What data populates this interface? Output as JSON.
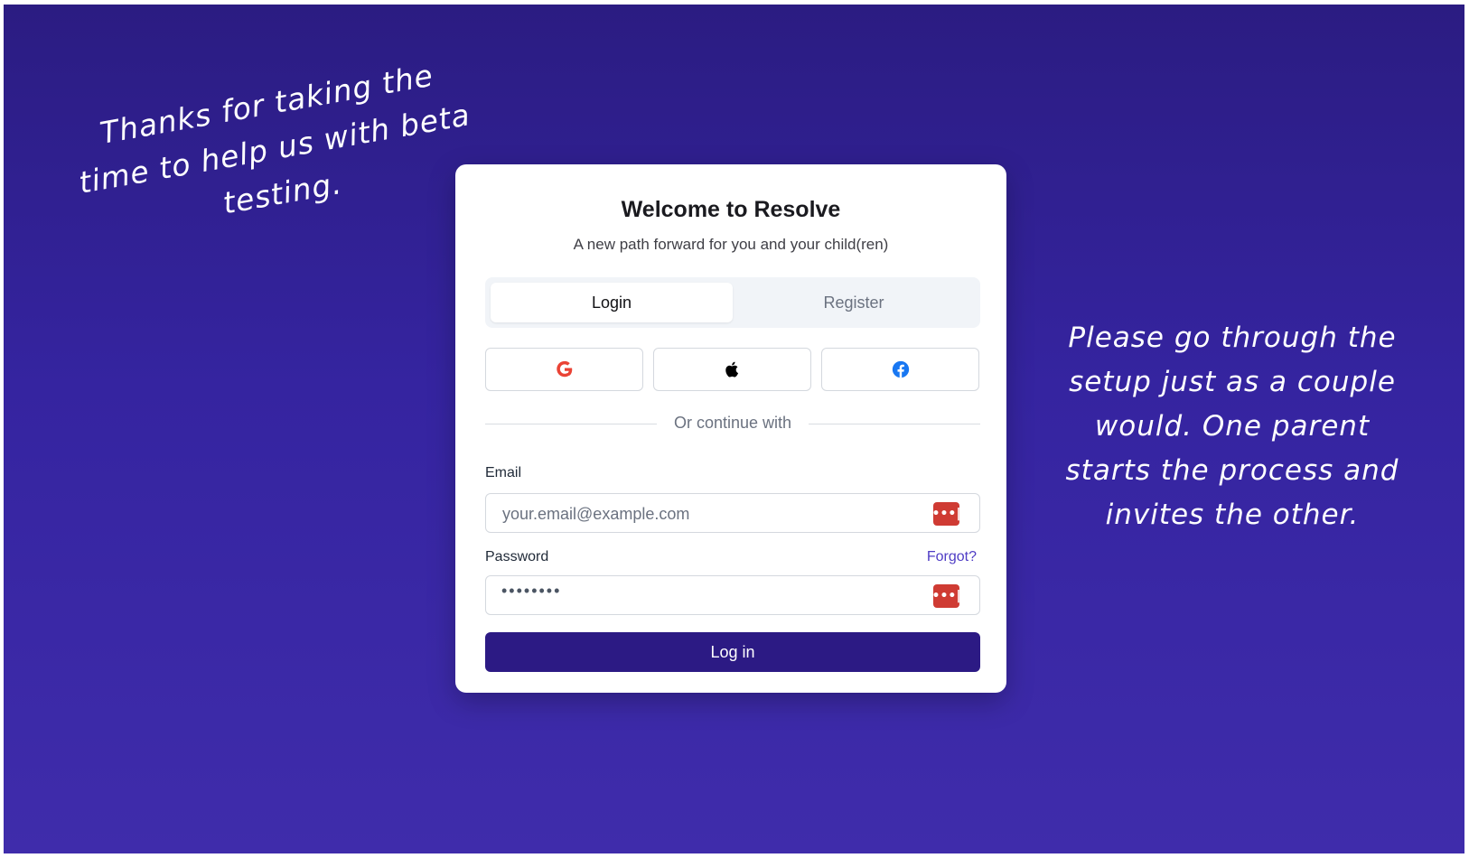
{
  "notes": {
    "left": "Thanks for taking the time to help us with beta testing.",
    "right": "Please go through the setup just as a couple would. One parent starts the process and invites the other."
  },
  "card": {
    "title": "Welcome to Resolve",
    "subtitle": "A new path forward for you and your child(ren)"
  },
  "tabs": {
    "login": "Login",
    "register": "Register",
    "active": "login"
  },
  "social": {
    "icons": [
      "google-icon",
      "apple-icon",
      "facebook-icon"
    ]
  },
  "divider": {
    "text": "Or continue with"
  },
  "form": {
    "email_label": "Email",
    "email_placeholder": "your.email@example.com",
    "password_label": "Password",
    "password_value": "••••••••",
    "forgot_label": "Forgot?",
    "submit_label": "Log in"
  },
  "colors": {
    "background_top": "#2b1c82",
    "background_bottom": "#3f2cab",
    "primary_button": "#2c1a84",
    "link": "#4f3dc5",
    "password_manager_icon": "#cf3b33",
    "google_red": "#ea4335",
    "facebook_blue": "#1877f2"
  }
}
